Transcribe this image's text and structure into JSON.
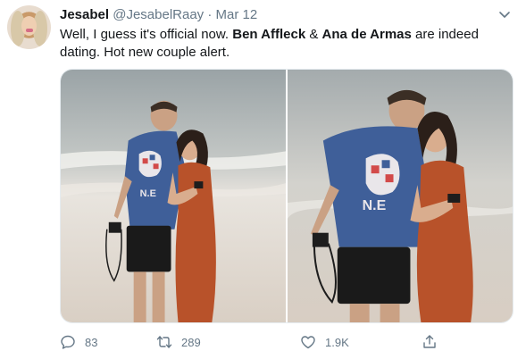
{
  "tweet": {
    "author_name": "Jesabel",
    "author_handle": "@JesabelRaay",
    "separator": "·",
    "date": "Mar 12",
    "text_part1": "Well, I guess it's official now. ",
    "mention1": "Ben Affleck",
    "text_part2": " & ",
    "mention2": "Ana de Armas",
    "text_part3": " are indeed dating. Hot new couple alert.",
    "shirt_text": "N.E"
  },
  "actions": {
    "replies": "83",
    "retweets": "289",
    "likes": "1.9K"
  },
  "colors": {
    "text": "#14171a",
    "secondary": "#657786",
    "shirt": "#3f5f99",
    "dress": "#b8522a"
  }
}
